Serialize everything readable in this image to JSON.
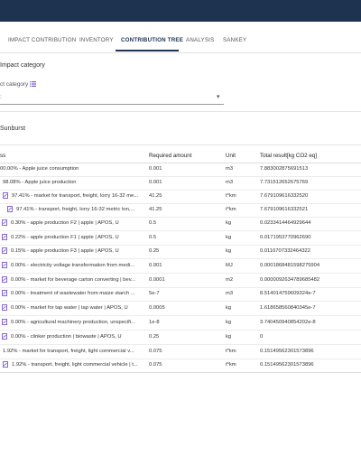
{
  "nav": {
    "tabs": [
      {
        "label": "IMPACT CONTRIBUTION"
      },
      {
        "label": "INVENTORY"
      },
      {
        "label": "CONTRIBUTION TREE",
        "active": true
      },
      {
        "label": "ANALYSIS"
      },
      {
        "label": "SANKEY"
      }
    ]
  },
  "impact": {
    "heading": "Impact category",
    "field_label": "ct category",
    "select_value": ":"
  },
  "view": {
    "label": "Sunburst"
  },
  "table": {
    "columns": {
      "name": "ss",
      "amount": "Required amount",
      "unit": "Unit",
      "result": "Total result[kg CO2 eq]"
    },
    "rows": [
      {
        "name": "00.00% - Apple juice consumption",
        "amount": "0.001",
        "unit": "m3",
        "result": "7.883002875691513",
        "icon": false
      },
      {
        "name": "98.08% - Apple juice production",
        "amount": "0.001",
        "unit": "m3",
        "result": "7.731512652675769",
        "icon": false
      },
      {
        "name": "97.41% - market for transport, freight, lorry 16-32 me...",
        "amount": "41.25",
        "unit": "t*km",
        "result": "7.679109616332520",
        "icon": true
      },
      {
        "name": "97.41% - transport, freight, lorry 16-32 metric ton,...",
        "amount": "41.25",
        "unit": "t*km",
        "result": "7.679109616332521",
        "icon": true
      },
      {
        "name": "0.30% - apple production F2 | apple | APOS, U",
        "amount": "0.5",
        "unit": "kg",
        "result": "0.0233414464929644",
        "icon": true
      },
      {
        "name": "0.22% - apple production F1 | apple | APOS, U",
        "amount": "0.5",
        "unit": "kg",
        "result": "0.0171953770962690",
        "icon": true
      },
      {
        "name": "0.15% - apple production F3 | apple | APOS, U",
        "amount": "0.25",
        "unit": "kg",
        "result": "0.0116707332464322",
        "icon": true
      },
      {
        "name": "0.00% - electricity voltage transformation from medi...",
        "amount": "0.001",
        "unit": "MJ",
        "result": "0.0001868481598275904",
        "icon": true
      },
      {
        "name": "0.00% - market for beverage carton converting | bev...",
        "amount": "0.0001",
        "unit": "m2",
        "result": "0.0000092634789685482",
        "icon": true
      },
      {
        "name": "0.00% - treatment of wastewater from maize starch ...",
        "amount": "5e-7",
        "unit": "m3",
        "result": "8.514014759609324e-7",
        "icon": true
      },
      {
        "name": "0.00% - market for tap water | tap water | APOS, U",
        "amount": "0.0005",
        "unit": "kg",
        "result": "1.618658560840345e-7",
        "icon": true
      },
      {
        "name": "0.00% - agricultural machinery production, unspecifi...",
        "amount": "1e-8",
        "unit": "kg",
        "result": "3.740450940854202e-8",
        "icon": true
      },
      {
        "name": "0.00% - clinker production | biowaste | APOS, U",
        "amount": "0.25",
        "unit": "kg",
        "result": "0",
        "icon": true
      },
      {
        "name": "1.92% - market for transport, freight, light commercial v...",
        "amount": "0.075",
        "unit": "t*km",
        "result": "0.15149562301573896",
        "icon": false
      },
      {
        "name": "1.92% - transport, freight, light commercial vehicle | t...",
        "amount": "0.075",
        "unit": "t*km",
        "result": "0.15149562301573896",
        "icon": true
      }
    ]
  },
  "colors": {
    "topbar": "#1d3350",
    "accent": "#1d3350",
    "icon": "#7b56c9"
  }
}
